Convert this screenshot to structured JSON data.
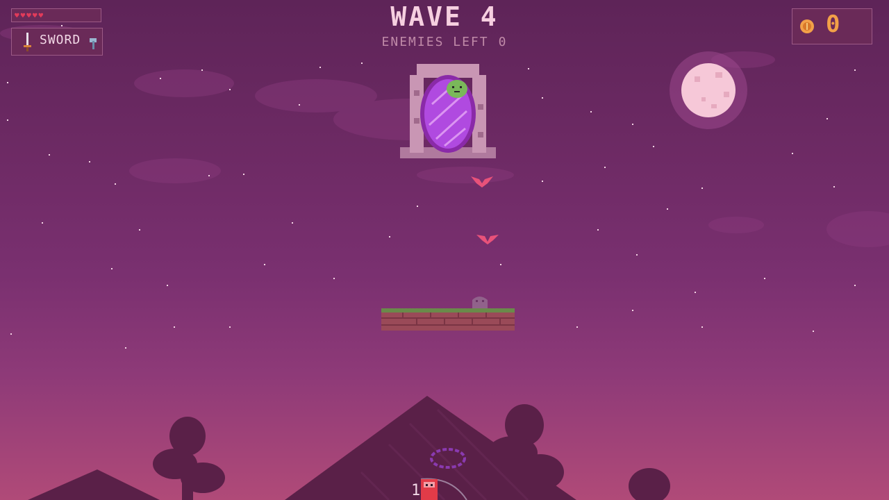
{
  "hud": {
    "health": {
      "max": 5,
      "current": 5,
      "heart_icon": "heart-icon"
    },
    "weapon": {
      "label": "SWORD",
      "icon": "sword-icon",
      "secondary_icon": "axe-icon"
    },
    "coins": {
      "count": "0",
      "icon": "coin-icon"
    }
  },
  "wave": {
    "title": "WAVE 4",
    "enemies_left_label": "ENEMIES LEFT",
    "enemies_left_count": "0"
  },
  "player": {
    "number_label": "1"
  },
  "colors": {
    "sky_top": "#5e2458",
    "sky_bottom": "#b04a78",
    "accent_coin": "#f2a048",
    "heart": "#e23b5a",
    "portal": "#b04ae0",
    "moon": "#f6c8d8",
    "hills": "#5a2048",
    "player": "#e23b48"
  }
}
